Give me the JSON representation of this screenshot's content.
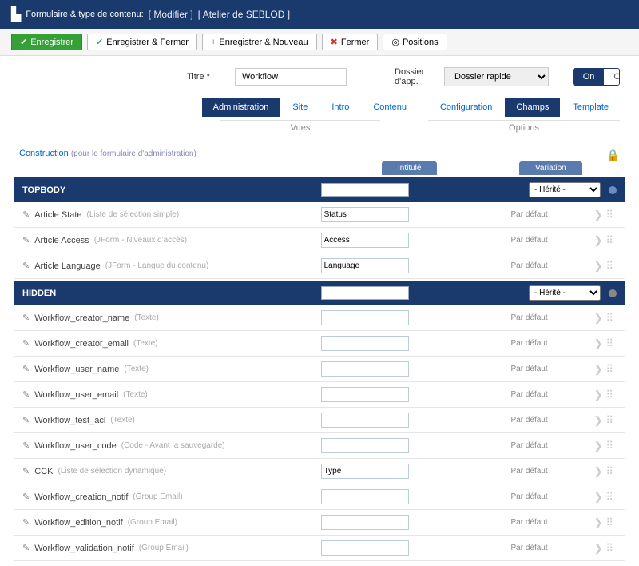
{
  "title": {
    "main": "Formulaire & type de contenu:",
    "sub1": "[ Modifier ]",
    "sub2": "[ Atelier de SEBLOD ]"
  },
  "toolbar": {
    "save": "Enregistrer",
    "saveclose": "Enregistrer & Fermer",
    "savenew": "Enregistrer & Nouveau",
    "close": "Fermer",
    "positions": "Positions"
  },
  "form": {
    "titre_label": "Titre *",
    "titre": "Workflow",
    "dossier_label": "Dossier d'app.",
    "dossier": "Dossier rapide",
    "on": "On",
    "off": "Off"
  },
  "tabs": {
    "admin": "Administration",
    "site": "Site",
    "intro": "Intro",
    "contenu": "Contenu",
    "config": "Configuration",
    "champs": "Champs",
    "template": "Template"
  },
  "subtabs": {
    "vues": "Vues",
    "options": "Options"
  },
  "construction": {
    "label": "Construction",
    "hint": "(pour le formulaire d'administration)"
  },
  "headers": {
    "intitule": "Intitulé",
    "variation": "Variation"
  },
  "sections": {
    "topbody": "TOPBODY",
    "hidden": "HIDDEN",
    "herite": "- Hérité -"
  },
  "defaut": "Par défaut",
  "fields1": [
    {
      "name": "Article State",
      "type": "(Liste de sélection simple)",
      "val": "Status"
    },
    {
      "name": "Article Access",
      "type": "(JForm - Niveaux d'accès)",
      "val": "Access"
    },
    {
      "name": "Article Language",
      "type": "(JForm - Langue du contenu)",
      "val": "Language"
    }
  ],
  "fields2": [
    {
      "name": "Workflow_creator_name",
      "type": "(Texte)",
      "val": ""
    },
    {
      "name": "Workflow_creator_email",
      "type": "(Texte)",
      "val": ""
    },
    {
      "name": "Workflow_user_name",
      "type": "(Texte)",
      "val": ""
    },
    {
      "name": "Workflow_user_email",
      "type": "(Texte)",
      "val": ""
    },
    {
      "name": "Workflow_test_acl",
      "type": "(Texte)",
      "val": ""
    },
    {
      "name": "Workflow_user_code",
      "type": "(Code - Avant la sauvegarde)",
      "val": ""
    },
    {
      "name": "CCK",
      "type": "(Liste de sélection dynamique)",
      "val": "Type"
    },
    {
      "name": "Workflow_creation_notif",
      "type": "(Group Email)",
      "val": ""
    },
    {
      "name": "Workflow_edition_notif",
      "type": "(Group Email)",
      "val": ""
    },
    {
      "name": "Workflow_validation_notif",
      "type": "(Group Email)",
      "val": ""
    }
  ]
}
